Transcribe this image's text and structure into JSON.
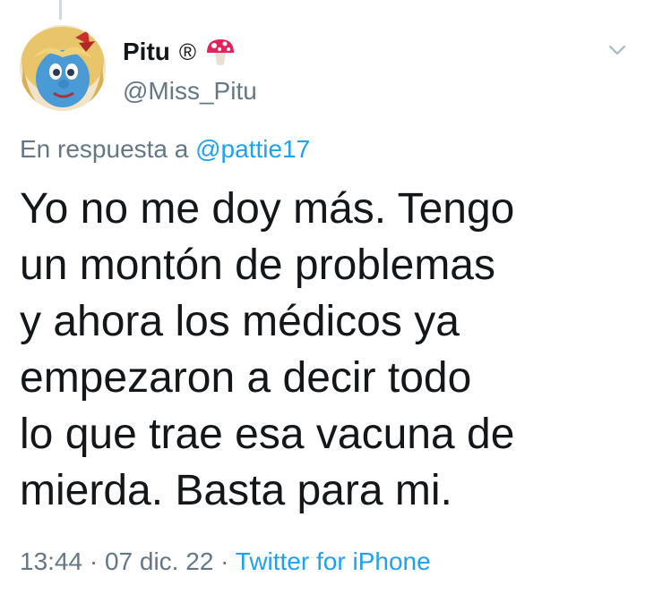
{
  "tweet": {
    "display_name": "Pitu",
    "registered_mark": "®",
    "name_emoji_icon": "mushroom-icon",
    "handle": "@Miss_Pitu",
    "reply_prefix": "En respuesta a",
    "reply_to": "@pattie17",
    "text": "Yo no me doy más. Tengo\nun montón de problemas\ny ahora los médicos ya\nempezaron a decir todo\nlo que trae esa vacuna de\nmierda. Basta para mi.",
    "time": "13:44",
    "separator": "·",
    "date": "07 dic. 22",
    "source": "Twitter for iPhone"
  },
  "icons": {
    "menu": "chevron-down-icon",
    "avatar": "avatar"
  },
  "colors": {
    "text": "#14171a",
    "secondary": "#657786",
    "link": "#1da1f2",
    "mushroom_red": "#e0245e"
  }
}
